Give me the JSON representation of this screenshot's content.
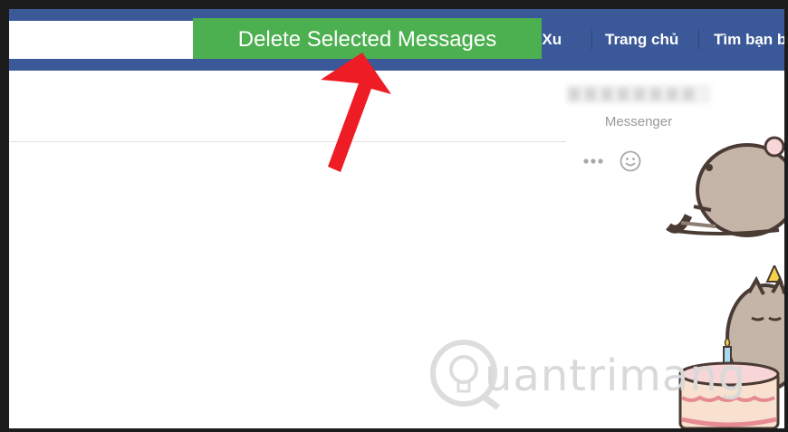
{
  "header": {
    "search_value": "",
    "nav_items": [
      {
        "label": "t Xu"
      },
      {
        "label": "Trang chủ"
      },
      {
        "label": "Tìm bạn b"
      }
    ]
  },
  "toolbar": {
    "delete_selected_label": "Delete Selected Messages"
  },
  "conversation": {
    "app_label": "Messenger",
    "more_icon": "ellipsis-icon",
    "emoji_icon": "smile-icon"
  },
  "watermark": {
    "text": "uantrimang"
  },
  "colors": {
    "header_blue": "#3b5998",
    "button_green": "#4caf50",
    "arrow_red": "#ee1c25"
  }
}
